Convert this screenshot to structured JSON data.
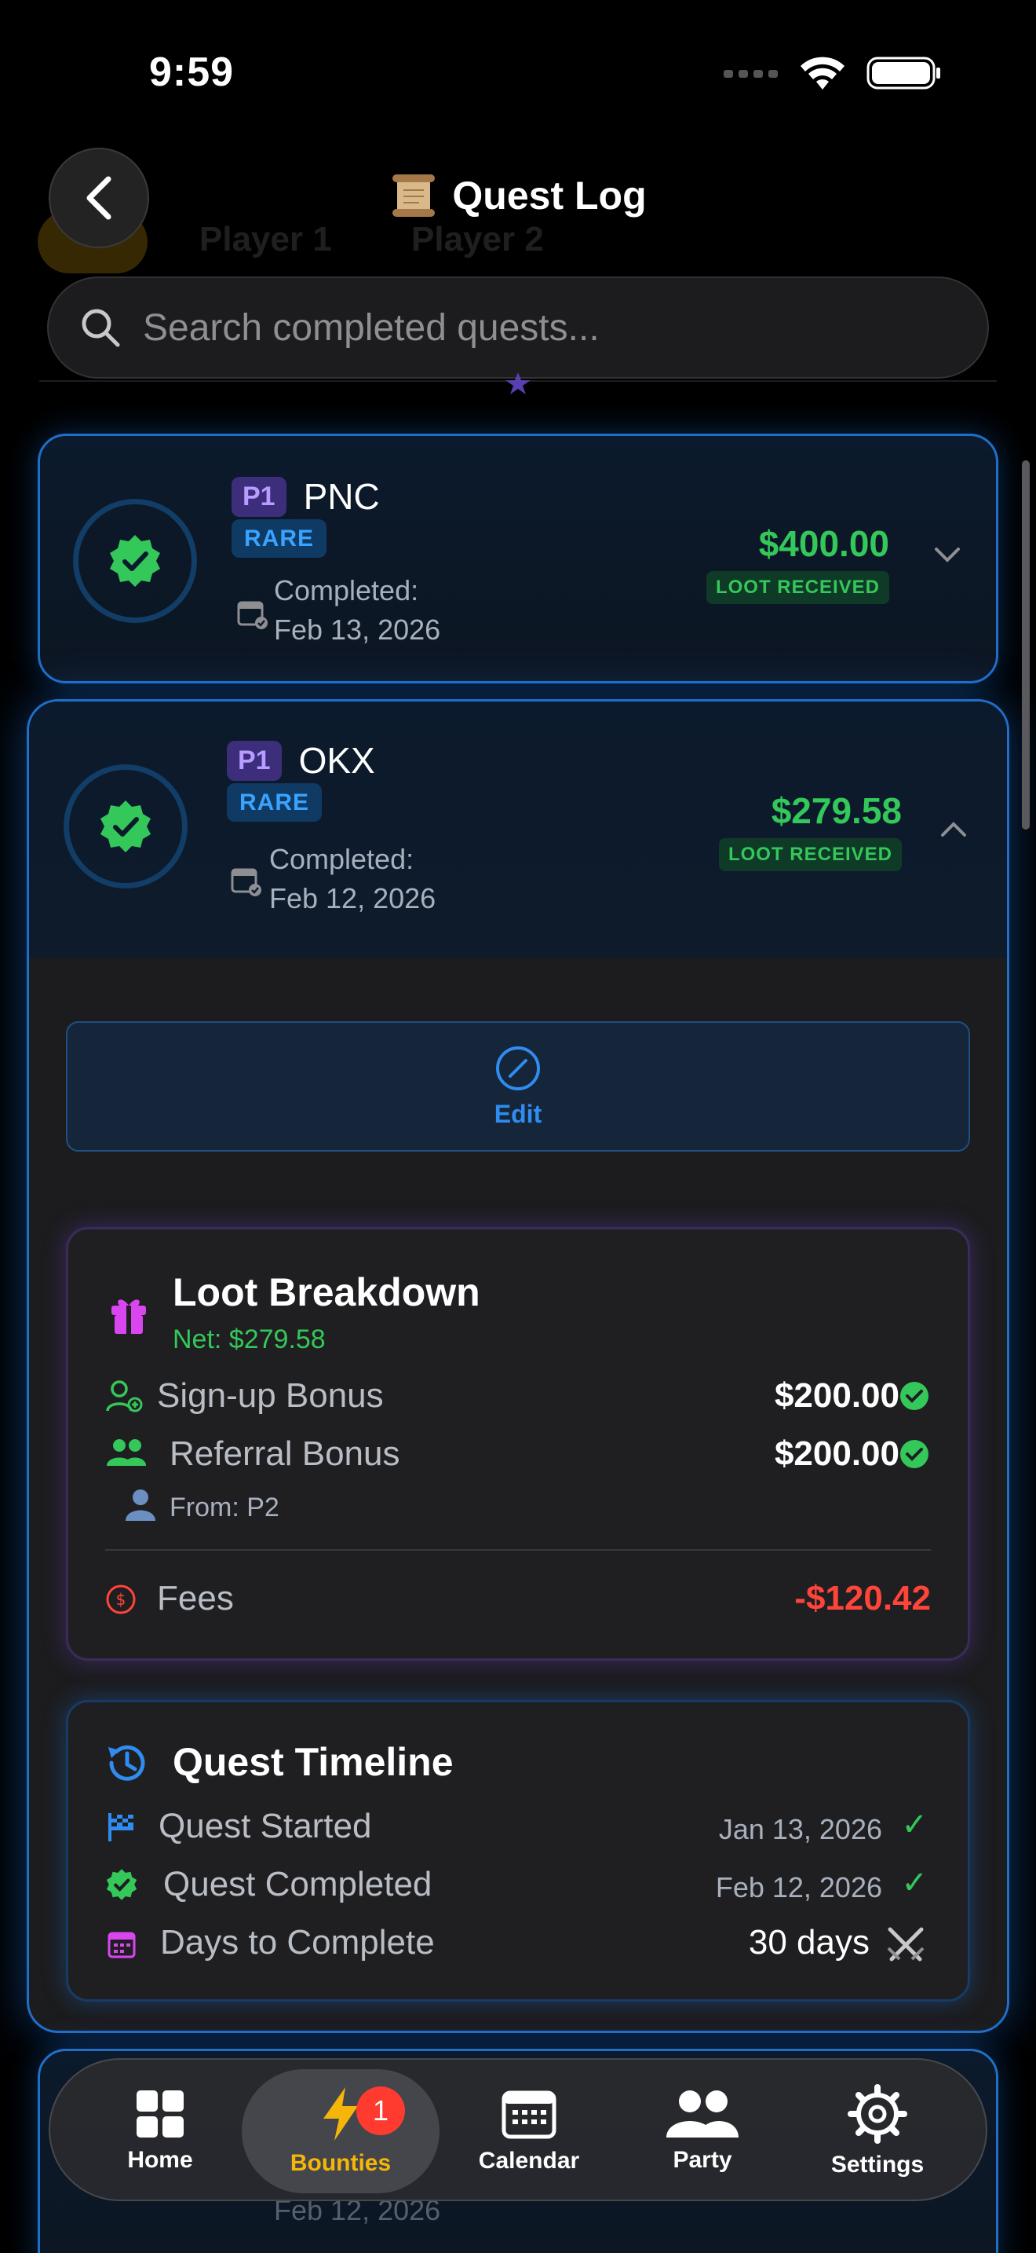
{
  "status": {
    "time": "9:59"
  },
  "header": {
    "title": "Quest Log",
    "title_icon": "scroll-icon"
  },
  "background_tabs": [
    "Player 1",
    "Player 2"
  ],
  "search": {
    "placeholder": "Search completed quests..."
  },
  "quests": [
    {
      "player": "P1",
      "name": "PNC",
      "rarity": "RARE",
      "completed_label": "Completed:",
      "completed_date": "Feb 13, 2026",
      "amount": "$400.00",
      "status": "LOOT RECEIVED"
    },
    {
      "player": "P1",
      "name": "OKX",
      "rarity": "RARE",
      "completed_label": "Completed:",
      "completed_date": "Feb 12, 2026",
      "amount": "$279.58",
      "status": "LOOT RECEIVED"
    }
  ],
  "bottom_card": {
    "completed_date": "Feb 12, 2026"
  },
  "edit": {
    "label": "Edit"
  },
  "loot_breakdown": {
    "title": "Loot Breakdown",
    "net": "Net: $279.58",
    "signup_label": "Sign-up Bonus",
    "signup_value": "$200.00",
    "referral_label": "Referral Bonus",
    "referral_value": "$200.00",
    "from": "From: P2",
    "fees_label": "Fees",
    "fees_value": "-$120.42"
  },
  "timeline": {
    "title": "Quest Timeline",
    "started_label": "Quest Started",
    "started_date": "Jan 13, 2026",
    "completed_label": "Quest Completed",
    "completed_date": "Feb 12, 2026",
    "days_label": "Days to Complete",
    "days_value": "30 days"
  },
  "tabbar": {
    "home": "Home",
    "bounties": "Bounties",
    "bounties_badge": "1",
    "calendar": "Calendar",
    "party": "Party",
    "settings": "Settings"
  },
  "colors": {
    "accent_blue": "#2f8cf0",
    "success": "#34c759",
    "danger": "#ff453a",
    "active_tab": "#f5b60a"
  }
}
